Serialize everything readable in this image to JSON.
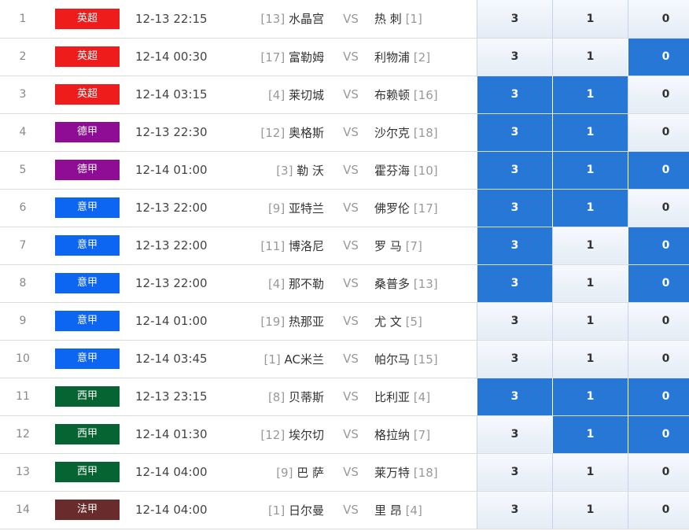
{
  "colors": {
    "league": {
      "英超": "#ef1c1c",
      "德甲": "#8f0d95",
      "意甲": "#0c66f2",
      "西甲": "#066332",
      "法甲": "#692b2b"
    },
    "selected": "#2778d6"
  },
  "vs_label": "VS",
  "matches": [
    {
      "idx": "1",
      "league": "英超",
      "time": "12-13 22:15",
      "home_rank": "[13]",
      "home": "水晶宫",
      "away": "热 刺",
      "away_rank": "[1]",
      "odds": [
        "3",
        "1",
        "0"
      ],
      "sel": [
        false,
        false,
        false
      ]
    },
    {
      "idx": "2",
      "league": "英超",
      "time": "12-14 00:30",
      "home_rank": "[17]",
      "home": "富勒姆",
      "away": "利物浦",
      "away_rank": "[2]",
      "odds": [
        "3",
        "1",
        "0"
      ],
      "sel": [
        false,
        false,
        true
      ]
    },
    {
      "idx": "3",
      "league": "英超",
      "time": "12-14 03:15",
      "home_rank": "[4]",
      "home": "莱切城",
      "away": "布赖顿",
      "away_rank": "[16]",
      "odds": [
        "3",
        "1",
        "0"
      ],
      "sel": [
        true,
        true,
        false
      ]
    },
    {
      "idx": "4",
      "league": "德甲",
      "time": "12-13 22:30",
      "home_rank": "[12]",
      "home": "奥格斯",
      "away": "沙尔克",
      "away_rank": "[18]",
      "odds": [
        "3",
        "1",
        "0"
      ],
      "sel": [
        true,
        true,
        false
      ]
    },
    {
      "idx": "5",
      "league": "德甲",
      "time": "12-14 01:00",
      "home_rank": "[3]",
      "home": "勒 沃",
      "away": "霍芬海",
      "away_rank": "[10]",
      "odds": [
        "3",
        "1",
        "0"
      ],
      "sel": [
        true,
        true,
        true
      ]
    },
    {
      "idx": "6",
      "league": "意甲",
      "time": "12-13 22:00",
      "home_rank": "[9]",
      "home": "亚特兰",
      "away": "佛罗伦",
      "away_rank": "[17]",
      "odds": [
        "3",
        "1",
        "0"
      ],
      "sel": [
        true,
        true,
        false
      ]
    },
    {
      "idx": "7",
      "league": "意甲",
      "time": "12-13 22:00",
      "home_rank": "[11]",
      "home": "博洛尼",
      "away": "罗 马",
      "away_rank": "[7]",
      "odds": [
        "3",
        "1",
        "0"
      ],
      "sel": [
        true,
        false,
        true
      ]
    },
    {
      "idx": "8",
      "league": "意甲",
      "time": "12-13 22:00",
      "home_rank": "[4]",
      "home": "那不勒",
      "away": "桑普多",
      "away_rank": "[13]",
      "odds": [
        "3",
        "1",
        "0"
      ],
      "sel": [
        true,
        false,
        true
      ]
    },
    {
      "idx": "9",
      "league": "意甲",
      "time": "12-14 01:00",
      "home_rank": "[19]",
      "home": "热那亚",
      "away": "尤 文",
      "away_rank": "[5]",
      "odds": [
        "3",
        "1",
        "0"
      ],
      "sel": [
        false,
        false,
        false
      ]
    },
    {
      "idx": "10",
      "league": "意甲",
      "time": "12-14 03:45",
      "home_rank": "[1]",
      "home": "AC米兰",
      "away": "帕尔马",
      "away_rank": "[15]",
      "odds": [
        "3",
        "1",
        "0"
      ],
      "sel": [
        false,
        false,
        false
      ]
    },
    {
      "idx": "11",
      "league": "西甲",
      "time": "12-13 23:15",
      "home_rank": "[8]",
      "home": "贝蒂斯",
      "away": "比利亚",
      "away_rank": "[4]",
      "odds": [
        "3",
        "1",
        "0"
      ],
      "sel": [
        true,
        true,
        true
      ]
    },
    {
      "idx": "12",
      "league": "西甲",
      "time": "12-14 01:30",
      "home_rank": "[12]",
      "home": "埃尔切",
      "away": "格拉纳",
      "away_rank": "[7]",
      "odds": [
        "3",
        "1",
        "0"
      ],
      "sel": [
        false,
        true,
        true
      ]
    },
    {
      "idx": "13",
      "league": "西甲",
      "time": "12-14 04:00",
      "home_rank": "[9]",
      "home": "巴 萨",
      "away": "莱万特",
      "away_rank": "[18]",
      "odds": [
        "3",
        "1",
        "0"
      ],
      "sel": [
        false,
        false,
        false
      ]
    },
    {
      "idx": "14",
      "league": "法甲",
      "time": "12-14 04:00",
      "home_rank": "[1]",
      "home": "日尔曼",
      "away": "里 昂",
      "away_rank": "[4]",
      "odds": [
        "3",
        "1",
        "0"
      ],
      "sel": [
        false,
        false,
        false
      ]
    }
  ]
}
